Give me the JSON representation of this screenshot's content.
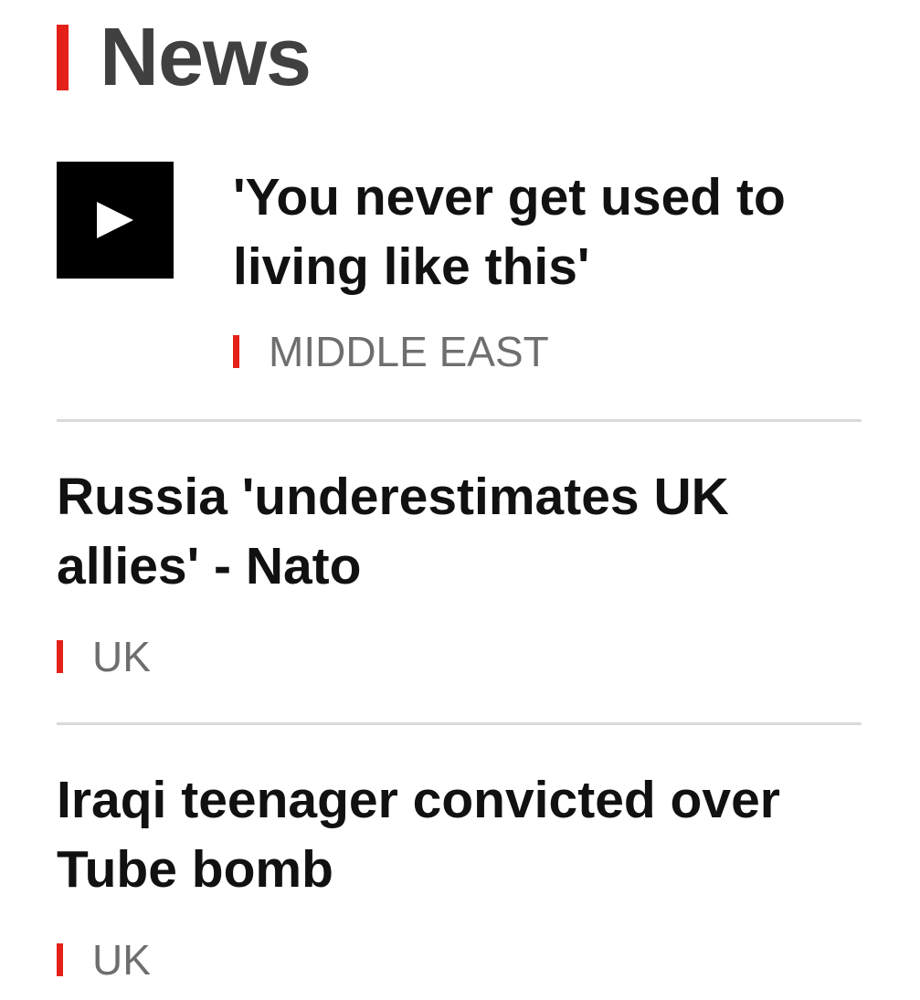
{
  "section": {
    "title": "News",
    "accent_color": "#e32119"
  },
  "stories": [
    {
      "headline": "'You never get used to living like this'",
      "tag": "MIDDLE EAST",
      "media": "play-icon"
    },
    {
      "headline": "Russia 'underestimates UK allies' - Nato",
      "tag": "UK"
    },
    {
      "headline": "Iraqi teenager convicted over Tube bomb",
      "tag": "UK"
    }
  ]
}
